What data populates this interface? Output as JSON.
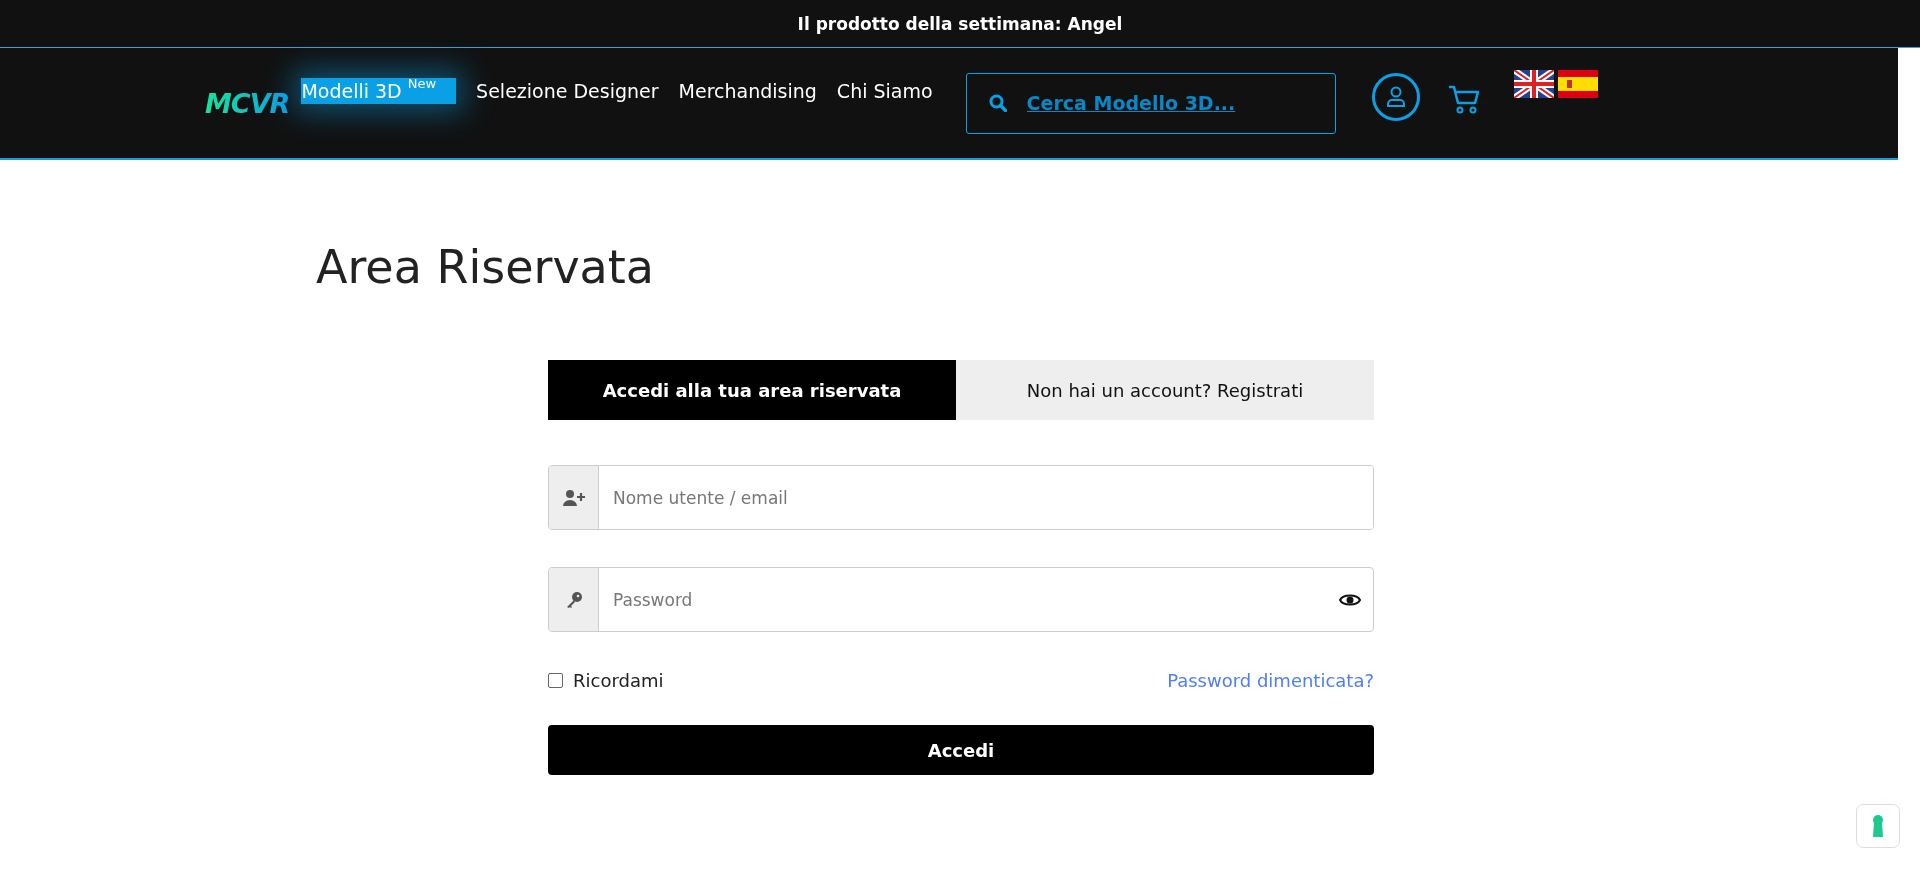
{
  "announcement": {
    "label": "Il prodotto della settimana:",
    "product": "Angel"
  },
  "header": {
    "logo": "MCVR",
    "nav": [
      {
        "label": "Modelli 3D",
        "badge": "New",
        "selected": true
      },
      {
        "label": "Selezione Designer",
        "selected": false
      },
      {
        "label": "Merchandising",
        "selected": false
      },
      {
        "label": "Chi Siamo",
        "selected": false
      }
    ],
    "search": {
      "placeholder": "Cerca Modello 3D..."
    }
  },
  "page": {
    "title": "Area Riservata"
  },
  "tabs": [
    {
      "label": "Accedi alla tua area riservata",
      "selected": true
    },
    {
      "label": "Non hai un account? Registrati",
      "selected": false
    }
  ],
  "form": {
    "username": {
      "placeholder": "Nome utente / email"
    },
    "password": {
      "placeholder": "Password"
    },
    "remember": {
      "label": "Ricordami",
      "checked": false
    },
    "forgot": "Password dimenticata?",
    "submit": "Accedi"
  }
}
